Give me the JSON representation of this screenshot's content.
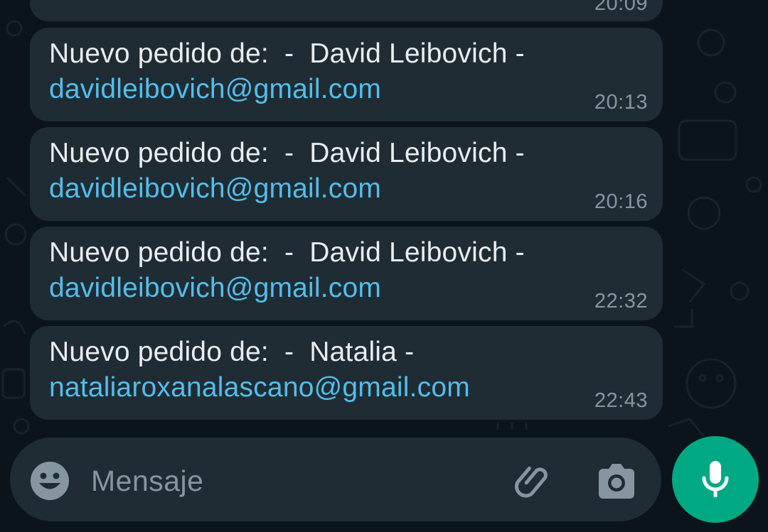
{
  "messages": [
    {
      "sender_text": "Nuevo pedido de:  -  David Leibovich -",
      "email": "davidleibovich@gmail.com",
      "time": "20:13"
    },
    {
      "sender_text": "Nuevo pedido de:  -  David Leibovich -",
      "email": "davidleibovich@gmail.com",
      "time": "20:16"
    },
    {
      "sender_text": "Nuevo pedido de:  -  David Leibovich -",
      "email": "davidleibovich@gmail.com",
      "time": "22:32"
    },
    {
      "sender_text": "Nuevo pedido de:  -  Natalia -",
      "email": "nataliaroxanalascano@gmail.com",
      "time": "22:43"
    }
  ],
  "previous_message": {
    "time": "20:09"
  },
  "composer": {
    "placeholder": "Mensaje",
    "icons": [
      "emoji-icon",
      "paperclip-icon",
      "camera-icon",
      "microphone-icon"
    ]
  },
  "colors": {
    "background": "#0b141a",
    "bubble": "#1f2c34",
    "text": "#e9edef",
    "link": "#53bdeb",
    "meta": "#8696a0",
    "accent": "#00a884"
  }
}
